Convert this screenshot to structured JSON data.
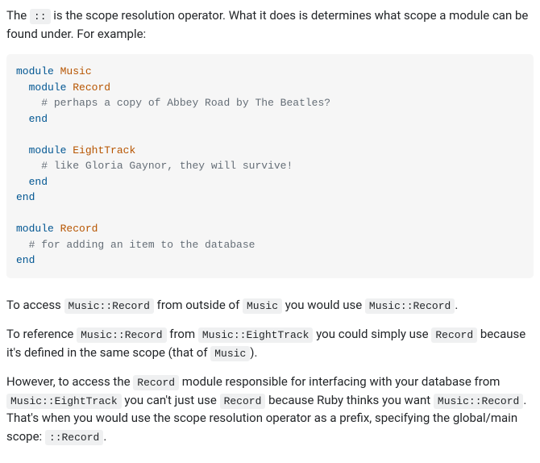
{
  "p1_a": "The ",
  "p1_code": "::",
  "p1_b": " is the scope resolution operator. What it does is determines what scope a module can be found under. For example:",
  "code": {
    "l1_kw": "module",
    "l1_const": "Music",
    "l2_kw": "module",
    "l2_const": "Record",
    "l3_comment": "# perhaps a copy of Abbey Road by The Beatles?",
    "l4_kw": "end",
    "l6_kw": "module",
    "l6_const": "EightTrack",
    "l7_comment": "# like Gloria Gaynor, they will survive!",
    "l8_kw": "end",
    "l9_kw": "end",
    "l11_kw": "module",
    "l11_const": "Record",
    "l12_comment": "# for adding an item to the database",
    "l13_kw": "end"
  },
  "p2_a": "To access ",
  "p2_code1": "Music::Record",
  "p2_b": " from outside of ",
  "p2_code2": "Music",
  "p2_c": " you would use ",
  "p2_code3": "Music::Record",
  "p2_d": ".",
  "p3_a": "To reference ",
  "p3_code1": "Music::Record",
  "p3_b": " from ",
  "p3_code2": "Music::EightTrack",
  "p3_c": " you could simply use ",
  "p3_code3": "Record",
  "p3_d": " because it's defined in the same scope (that of ",
  "p3_code4": "Music",
  "p3_e": ").",
  "p4_a": "However, to access the ",
  "p4_code1": "Record",
  "p4_b": " module responsible for interfacing with your database from ",
  "p4_code2": "Music::EightTrack",
  "p4_c": " you can't just use ",
  "p4_code3": "Record",
  "p4_d": " because Ruby thinks you want ",
  "p4_code4": "Music::Record",
  "p4_e": ". That's when you would use the scope resolution operator as a prefix, specifying the global/main scope: ",
  "p4_code5": "::Record",
  "p4_f": "."
}
